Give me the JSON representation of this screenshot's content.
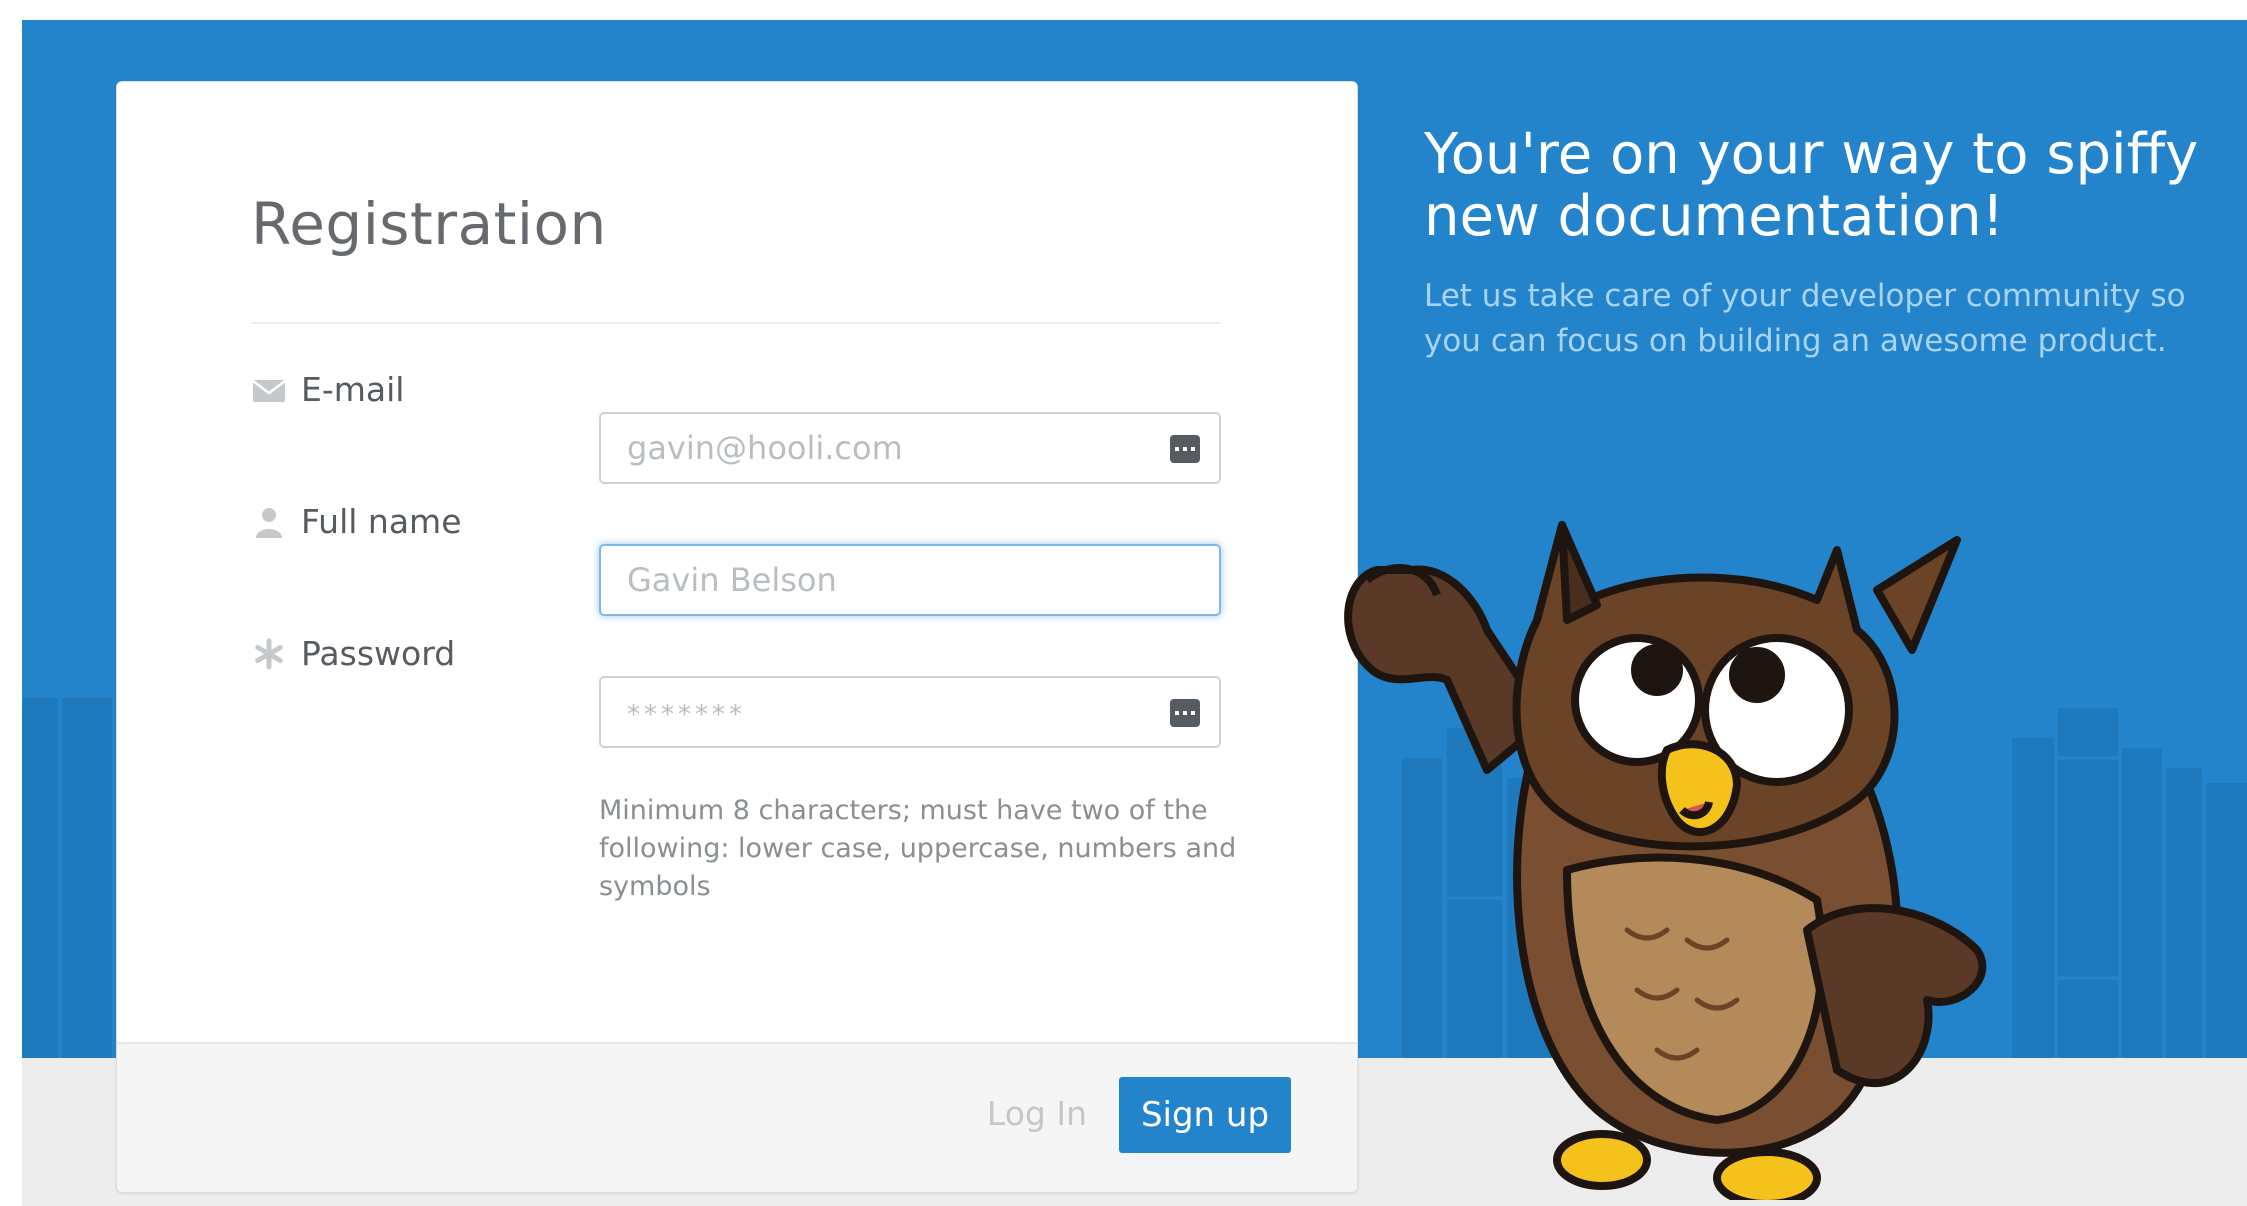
{
  "form": {
    "title": "Registration",
    "fields": [
      {
        "label": "E-mail",
        "value": "gavin@hooli.com",
        "icon": "envelope-icon"
      },
      {
        "label": "Full name",
        "value": "Gavin Belson",
        "icon": "user-icon"
      },
      {
        "label": "Password",
        "value": "*******",
        "icon": "asterisk-icon"
      }
    ],
    "password_hint": "Minimum 8 characters; must have two of the following: lower case, uppercase, numbers and symbols",
    "login_label": "Log In",
    "signup_label": "Sign up"
  },
  "hero": {
    "title": "You're on your way to spiffy new documentation!",
    "subtitle": "Let us take care of your developer community so you can focus on building an awesome product."
  },
  "colors": {
    "brand_blue": "#2384cb",
    "focus_glow": "#7fb9e6"
  },
  "icons": [
    "envelope-icon",
    "user-icon",
    "asterisk-icon",
    "keyboard-icon",
    "owl-mascot"
  ]
}
